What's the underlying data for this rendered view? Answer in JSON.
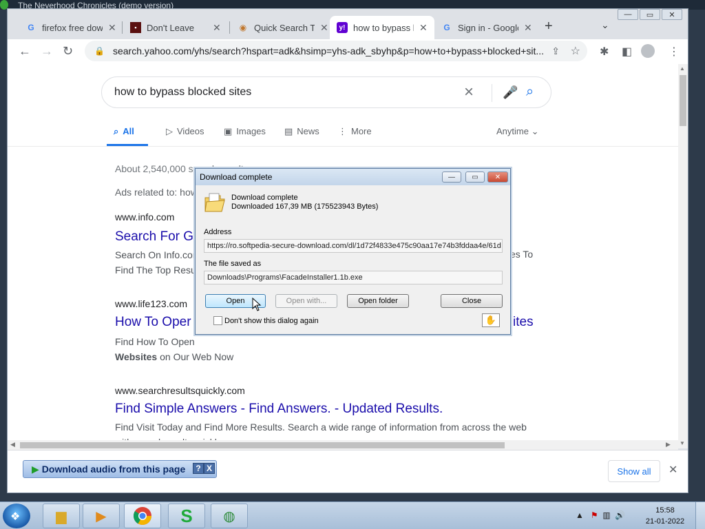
{
  "desktop": {
    "window_title": "The Neverhood Chronicles (demo version)"
  },
  "browser": {
    "tabs": [
      {
        "label": "firefox free dow",
        "icon": "google-icon",
        "active": false
      },
      {
        "label": "Don't Leave",
        "icon": "app-icon",
        "active": false
      },
      {
        "label": "Quick Search To",
        "icon": "search-app-icon",
        "active": false
      },
      {
        "label": "how to bypass b",
        "icon": "yahoo-icon",
        "active": true
      },
      {
        "label": "Sign in - Google",
        "icon": "google-icon",
        "active": false
      }
    ],
    "url": "search.yahoo.com/yhs/search?hspart=adk&hsimp=yhs-adk_sbyhp&p=how+to+bypass+blocked+sit..."
  },
  "search": {
    "query": "how to bypass blocked sites",
    "tabs": [
      {
        "label": "All",
        "icon": "search-icon",
        "active": true
      },
      {
        "label": "Videos",
        "icon": "play-icon",
        "active": false
      },
      {
        "label": "Images",
        "icon": "image-icon",
        "active": false
      },
      {
        "label": "News",
        "icon": "news-icon",
        "active": false
      },
      {
        "label": "More",
        "icon": "more-icon",
        "active": false
      }
    ],
    "anytime": "Anytime",
    "result_count": "About 2,540,000 search results",
    "ads_prefix": "Ads related to: how",
    "results": [
      {
        "site": "www.info.com",
        "title": "Search For G",
        "desc": "Search On Info.com",
        "desc2": "Find The Top Resul",
        "peek_right": "es To"
      },
      {
        "site": "www.life123.com",
        "title": "How To Oper",
        "title_right": "ites",
        "desc": "Find How To Open",
        "desc_bold": "Websites",
        "desc_tail": " on Our Web Now"
      },
      {
        "site": "www.searchresultsquickly.com",
        "title": "Find Simple Answers - Find Answers. - Updated Results.",
        "desc": "Find Visit Today and Find More Results. Search a wide range of information from across the web",
        "desc2": "with searchresultsquickly.com."
      }
    ]
  },
  "downloads_bar": {
    "audio_label": "Download audio from this page",
    "help": "?",
    "close": "X",
    "show_all": "Show all"
  },
  "dialog": {
    "title": "Download complete",
    "line1": "Download complete",
    "line2": "Downloaded 167,39  MB (175523943 Bytes)",
    "address_label": "Address",
    "address": "https://ro.softpedia-secure-download.com/dl/1d72f4833e475c90aa17e74b3fddaa4e/61d",
    "saved_label": "The file saved as",
    "saved_path": "Downloads\\Programs\\FacadeInstaller1.1b.exe",
    "btn_open": "Open",
    "btn_open_with": "Open with...",
    "btn_open_folder": "Open folder",
    "btn_close": "Close",
    "dont_show": "Don't show this dialog again"
  },
  "taskbar": {
    "time": "15:58",
    "date": "21-01-2022"
  },
  "colors": {
    "accent": "#1a73e8",
    "link": "#1a0dab"
  }
}
